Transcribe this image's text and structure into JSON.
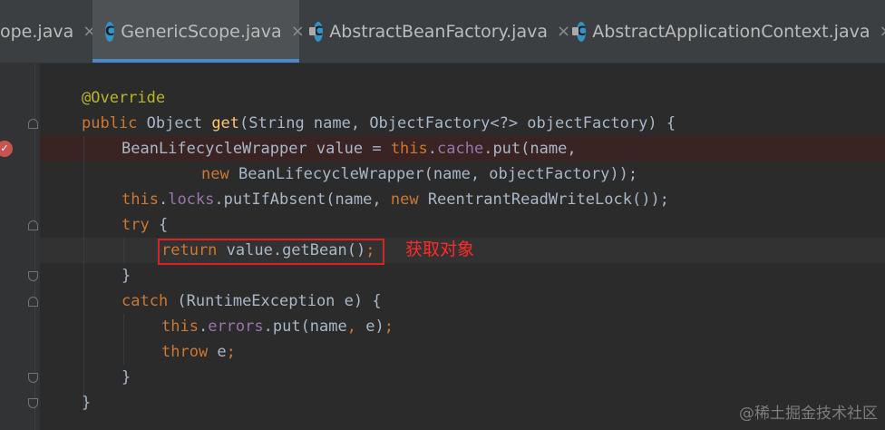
{
  "tabs": [
    {
      "label": "ope.java",
      "active": false,
      "close": "×"
    },
    {
      "label": "GenericScope.java",
      "active": true,
      "close": "×"
    },
    {
      "label": "AbstractBeanFactory.java",
      "active": false,
      "close": "×"
    },
    {
      "label": "AbstractApplicationContext.java",
      "active": false,
      "close": "×"
    }
  ],
  "icons": {
    "class_icon": "java-class-icon",
    "class_icon_letter": "C",
    "breakpoint": "breakpoint-icon"
  },
  "code": {
    "l1": {
      "a": "@Override"
    },
    "l2": {
      "k1": "public",
      "t1": " Object ",
      "f1": "get",
      "t2": "(String name, ObjectFactory<?> objectFactory) {"
    },
    "l3": {
      "t1": "BeanLifecycleWrapper value = ",
      "k1": "this",
      "t2": ".",
      "p1": "cache",
      "t3": ".put(name,"
    },
    "l4": {
      "k1": "new",
      "t1": " BeanLifecycleWrapper(name, objectFactory));"
    },
    "l5": {
      "k1": "this",
      "t1": ".",
      "p1": "locks",
      "t2": ".putIfAbsent(name, ",
      "k2": "new",
      "t3": " ReentrantReadWriteLock());"
    },
    "l6": {
      "k1": "try",
      "t1": " {"
    },
    "l7": {
      "k1": "return",
      "t1": " value.getBean()",
      "k2": ";"
    },
    "l8": {
      "t1": "}"
    },
    "l9": {
      "k1": "catch",
      "t1": " (RuntimeException e) {"
    },
    "l10": {
      "k1": "this",
      "t1": ".",
      "p1": "errors",
      "t2": ".put(name",
      "k2": ",",
      "t3": " e)",
      "k3": ";"
    },
    "l11": {
      "k1": "throw",
      "t1": " e",
      "k2": ";"
    },
    "l12": {
      "t1": "}"
    },
    "l13": {
      "t1": "}"
    }
  },
  "annotation": {
    "note": "获取对象",
    "highlight_color": "#e02020"
  },
  "watermark": "@稀土掘金技术社区",
  "colors": {
    "keyword": "#cc7832",
    "annotation": "#bbb529",
    "method": "#ffc66d",
    "field": "#9876aa",
    "text": "#a9b7c6",
    "background": "#2b2b2b",
    "tab_underline": "#4a88c7"
  }
}
